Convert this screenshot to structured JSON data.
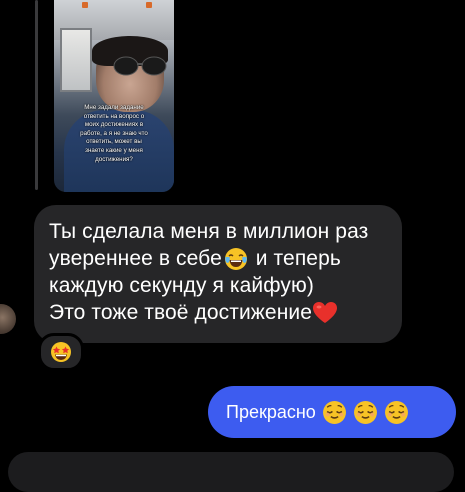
{
  "story_reply": {
    "caption": "Мне задали задание ответить на вопрос о моих достижениях в работе, а я не знаю что ответить, может вы знаете какие у меня достижения?"
  },
  "incoming_message": {
    "line1": "Ты сделала меня в миллион раз",
    "line2_before": "увереннее в себе",
    "line2_emoji": "face-with-tears-of-joy",
    "line2_after": " и теперь",
    "line3": "каждую секунду я кайфую)",
    "line4": "Это тоже твоё достижение",
    "line4_emoji": "red-heart",
    "bubble_color": "#262628"
  },
  "reaction": {
    "emoji": "star-struck"
  },
  "outgoing_message": {
    "text": "Прекрасно",
    "emojis": [
      "relieved-face",
      "relieved-face",
      "relieved-face"
    ],
    "bubble_color": "#3d5cf0"
  },
  "colors": {
    "background": "#000000",
    "text": "#ffffff",
    "heart": "#e8302b"
  }
}
